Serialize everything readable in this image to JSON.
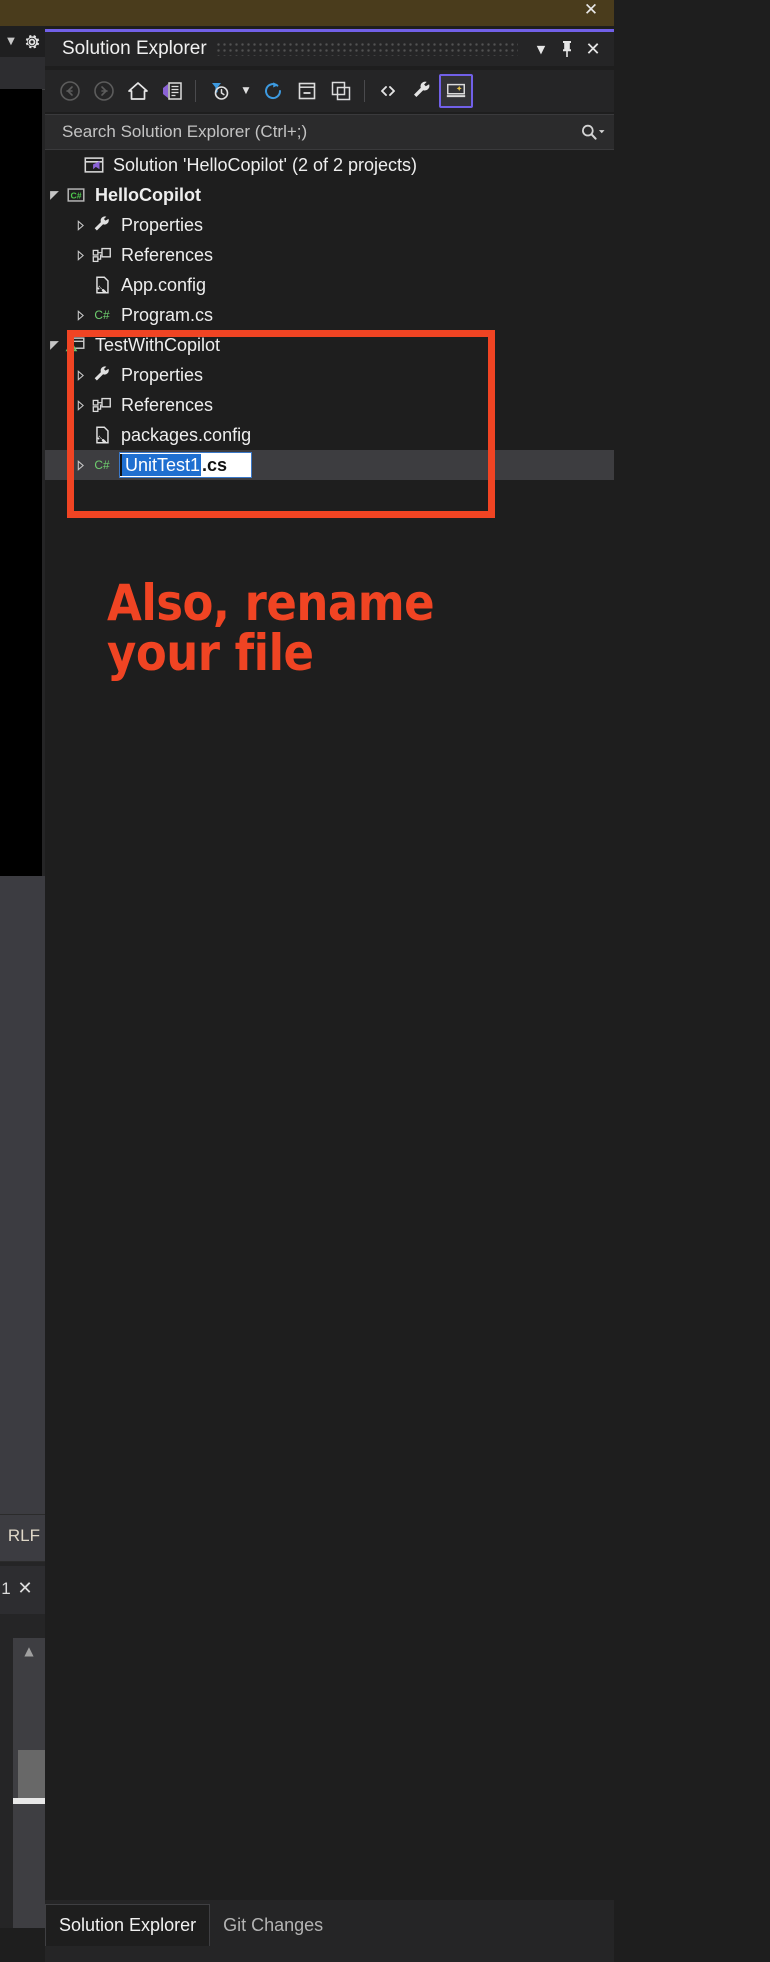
{
  "window": {
    "title": "Solution Explorer",
    "accent_color": "#7160e8",
    "chevron_icon": "chevron-down-icon",
    "pin_icon": "pin-icon",
    "close_icon": "close-icon"
  },
  "editor_chrome": {
    "close_icon": "close-icon",
    "caret_icon": "chevron-down-icon",
    "gear_icon": "gear-icon",
    "line_ending": "RLF",
    "pane_number": "1",
    "pane_close_icon": "close-icon",
    "scroll_up_icon": "scroll-up-arrow-icon",
    "scroll_down_icon": "scroll-down-arrow-icon"
  },
  "toolbar": {
    "items": [
      {
        "name": "back-button",
        "icon": "back-arrow-icon",
        "enabled": false
      },
      {
        "name": "forward-button",
        "icon": "forward-arrow-icon",
        "enabled": false
      },
      {
        "name": "home-button",
        "icon": "home-icon",
        "enabled": true
      },
      {
        "name": "solution-overview-button",
        "icon": "solution-overview-icon",
        "enabled": true
      },
      {
        "name": "pending-changes-filter-button",
        "icon": "filter-clock-icon",
        "enabled": true
      },
      {
        "name": "filter-dropdown-button",
        "icon": "chevron-down-icon",
        "enabled": true
      },
      {
        "name": "refresh-button",
        "icon": "refresh-icon",
        "enabled": true
      },
      {
        "name": "collapse-all-button",
        "icon": "collapse-all-icon",
        "enabled": true
      },
      {
        "name": "show-all-files-button",
        "icon": "show-all-files-icon",
        "enabled": true
      },
      {
        "name": "view-code-button",
        "icon": "angle-brackets-icon",
        "enabled": true
      },
      {
        "name": "properties-button",
        "icon": "wrench-icon",
        "enabled": true
      },
      {
        "name": "preview-selected-items-button",
        "icon": "preview-pane-icon",
        "enabled": true,
        "active": true
      }
    ]
  },
  "search": {
    "placeholder": "Search Solution Explorer (Ctrl+;)",
    "value": "",
    "icon": "search-icon",
    "dropdown_icon": "chevron-down-icon"
  },
  "tree": {
    "nodes": [
      {
        "name": "solution-node",
        "label": "Solution 'HelloCopilot' (2 of 2 projects)",
        "icon": "solution-icon",
        "indent": 1,
        "twisty": "none",
        "bold": false
      },
      {
        "name": "project-hellocopilot",
        "label": "HelloCopilot",
        "icon": "csharp-project-icon",
        "indent": 1,
        "twisty": "expanded",
        "bold": true
      },
      {
        "name": "hellocopilot-properties",
        "label": "Properties",
        "icon": "wrench-icon",
        "indent": 2,
        "twisty": "collapsed",
        "bold": false
      },
      {
        "name": "hellocopilot-references",
        "label": "References",
        "icon": "references-icon",
        "indent": 2,
        "twisty": "collapsed",
        "bold": false
      },
      {
        "name": "hellocopilot-app-config",
        "label": "App.config",
        "icon": "config-file-icon",
        "indent": 2,
        "twisty": "none",
        "bold": false
      },
      {
        "name": "hellocopilot-program-cs",
        "label": "Program.cs",
        "icon": "csharp-file-icon",
        "indent": 2,
        "twisty": "collapsed",
        "bold": false
      },
      {
        "name": "project-testwithcopilot",
        "label": "TestWithCopilot",
        "icon": "test-project-icon",
        "indent": 1,
        "twisty": "expanded",
        "bold": false
      },
      {
        "name": "testwithcopilot-properties",
        "label": "Properties",
        "icon": "wrench-icon",
        "indent": 2,
        "twisty": "collapsed",
        "bold": false
      },
      {
        "name": "testwithcopilot-references",
        "label": "References",
        "icon": "references-icon",
        "indent": 2,
        "twisty": "collapsed",
        "bold": false
      },
      {
        "name": "testwithcopilot-packages-config",
        "label": "packages.config",
        "icon": "config-file-icon",
        "indent": 2,
        "twisty": "none",
        "bold": false
      }
    ],
    "rename_row": {
      "name": "rename-row-unittest1",
      "icon": "csharp-file-icon",
      "twisty": "collapsed",
      "selected_text": "UnitTest1",
      "extension_text": ".cs",
      "selection_color": "#1f6fd0"
    }
  },
  "annotation": {
    "color": "#f04423",
    "line1": "Also, rename",
    "line2": "your file",
    "highlight_box": "red-highlight-box"
  },
  "tabs": [
    {
      "name": "tab-solution-explorer",
      "label": "Solution Explorer",
      "active": true
    },
    {
      "name": "tab-git-changes",
      "label": "Git Changes",
      "active": false
    }
  ]
}
